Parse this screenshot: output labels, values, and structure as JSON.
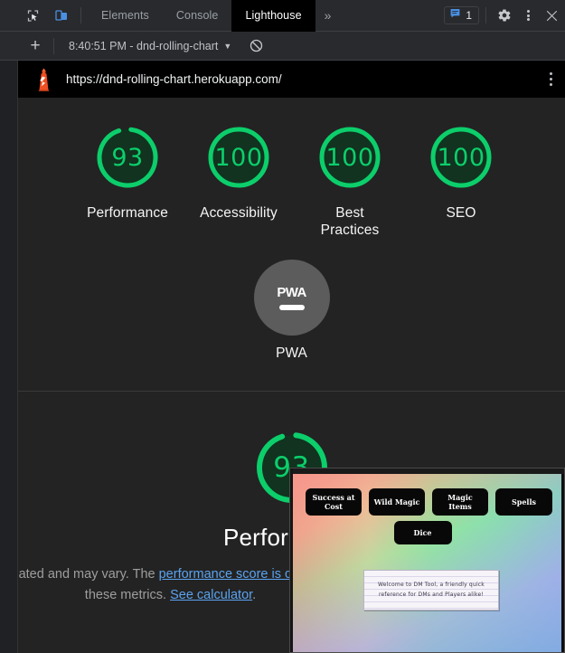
{
  "devtools": {
    "icons": {
      "inspect": "inspect-element-icon",
      "device_toggle": "device-toolbar-icon",
      "messages": "messages-icon",
      "settings": "gear-icon",
      "more": "kebab-menu-icon",
      "close": "close-icon"
    },
    "tabs": [
      {
        "label": "Elements",
        "active": false
      },
      {
        "label": "Console",
        "active": false
      },
      {
        "label": "Lighthouse",
        "active": true
      }
    ],
    "more_tabs_label": "»",
    "message_count": "1"
  },
  "lighthouse_toolbar": {
    "add_label": "+",
    "run_label": "8:40:51 PM - dnd-rolling-chart",
    "caret": "▼",
    "clear_icon": "clear-all-icon"
  },
  "report": {
    "url": "https://dnd-rolling-chart.herokuapp.com/",
    "logo_icon": "lighthouse-logo-icon",
    "kebab_icon": "report-options-icon",
    "scores": [
      {
        "value": "93",
        "label": "Performance",
        "percent": 93
      },
      {
        "value": "100",
        "label": "Accessibility",
        "percent": 100
      },
      {
        "value": "100",
        "label": "Best Practices",
        "percent": 100
      },
      {
        "value": "100",
        "label": "SEO",
        "percent": 100
      }
    ],
    "pwa": {
      "badge_text": "PWA",
      "label": "PWA"
    },
    "performance_section": {
      "value": "93",
      "percent": 93,
      "title": "Performance",
      "desc_part1": "Values are estimated and may vary. The ",
      "desc_link1": "performance score is calculated",
      "desc_part2": " directly from these metrics. ",
      "desc_link2": "See calculator",
      "desc_part3": "."
    },
    "colors": {
      "pass_green": "#0cce6b",
      "gauge_fill": "#11331f",
      "pwa_gray": "#5c5c5c",
      "link_blue": "#5aa3f0"
    }
  },
  "thumbnail": {
    "buttons": [
      "Success at Cost",
      "Wild Magic",
      "Magic Items",
      "Spells"
    ],
    "dice_button": "Dice",
    "note_line1": "Welcome to DM Tool, a friendly quick",
    "note_line2": "reference for DMs and Players alike!"
  }
}
